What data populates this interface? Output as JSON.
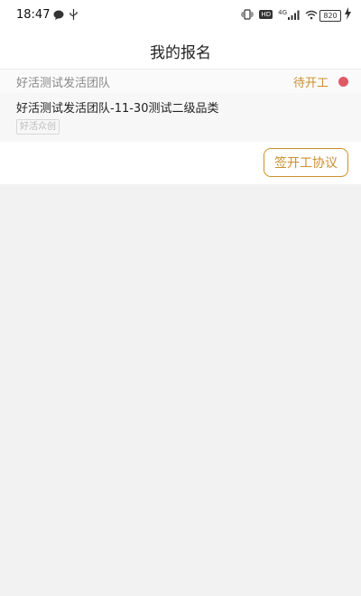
{
  "status_bar": {
    "time": "18:47",
    "hd_badge": "HD",
    "network": "4G",
    "battery": "820"
  },
  "nav": {
    "title": "我的报名"
  },
  "signup": {
    "team_name": "好活测试发活团队",
    "status": "待开工",
    "status_dot_color": "#e05a66",
    "job_title": "好活测试发活团队-11-30测试二级品类",
    "tag": "好活众创",
    "sign_button_label": "签开工协议"
  },
  "colors": {
    "accent": "#c9902f",
    "background": "#f2f2f2"
  }
}
